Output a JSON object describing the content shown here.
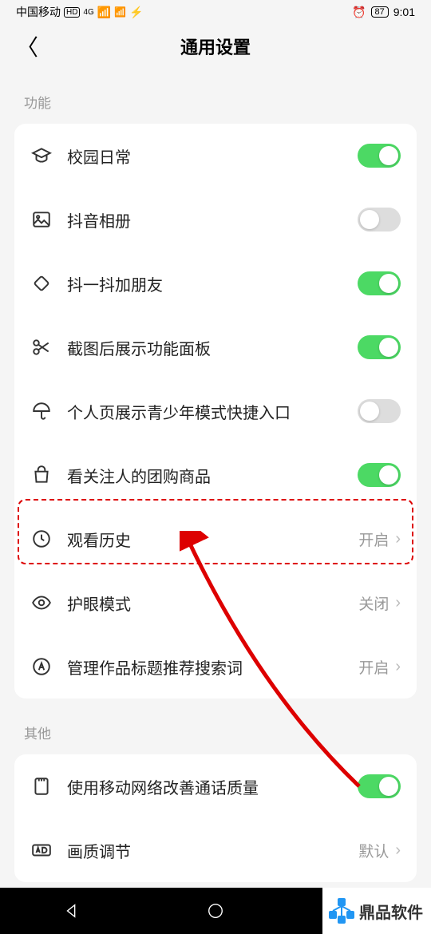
{
  "status_bar": {
    "carrier": "中国移动",
    "hd": "HD",
    "net": "4G",
    "battery": "87",
    "time": "9:01"
  },
  "nav": {
    "title": "通用设置"
  },
  "sections": {
    "func_label": "功能",
    "other_label": "其他"
  },
  "rows": {
    "campus": "校园日常",
    "album": "抖音相册",
    "shake": "抖一抖加朋友",
    "screenshot": "截图后展示功能面板",
    "teen": "个人页展示青少年模式快捷入口",
    "group": "看关注人的团购商品",
    "history": "观看历史",
    "history_val": "开启",
    "eye": "护眼模式",
    "eye_val": "关闭",
    "manage": "管理作品标题推荐搜索词",
    "manage_val": "开启",
    "mobile": "使用移动网络改善通话质量",
    "quality": "画质调节",
    "quality_val": "默认"
  },
  "footer": {
    "brand": "鼎品软件"
  }
}
